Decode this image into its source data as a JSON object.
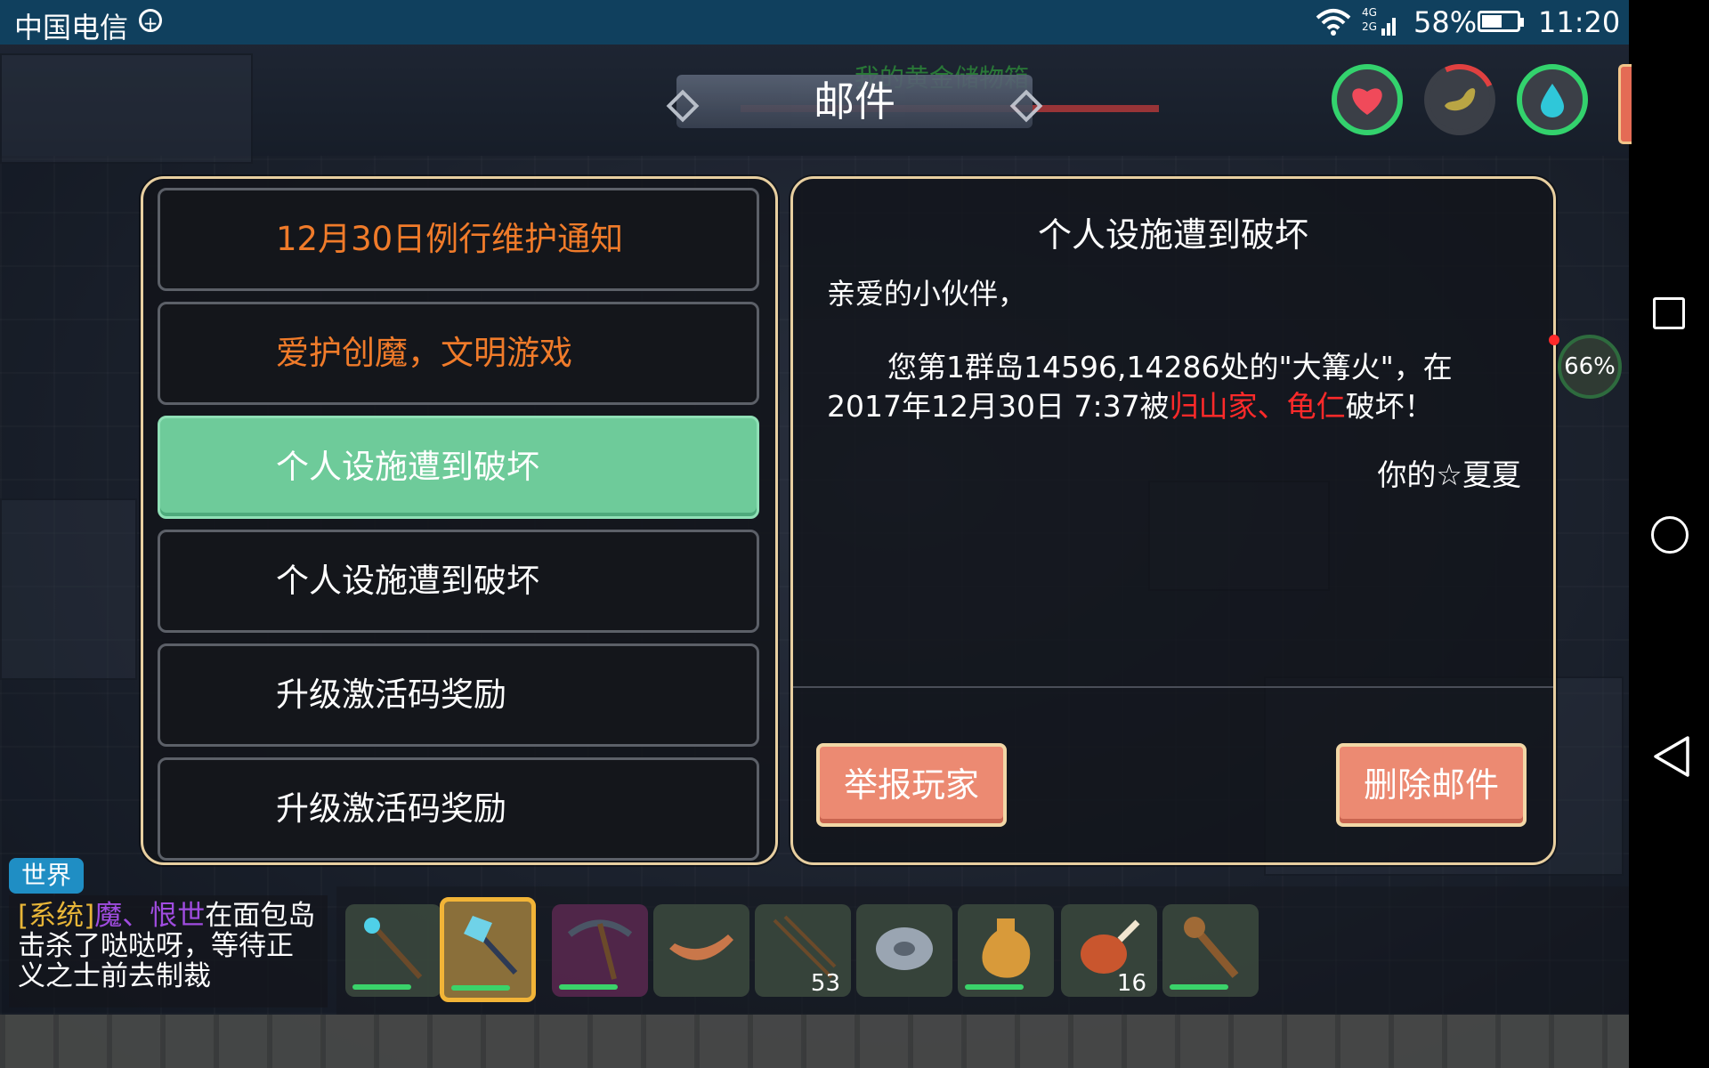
{
  "status_bar": {
    "carrier": "中国电信",
    "battery_percent": "58%",
    "time": "11:20",
    "network_label_top": "4G",
    "network_label_bottom": "2G"
  },
  "hud": {
    "page_title": "邮件",
    "chest_label": "我的黄金储物箱",
    "progress_badge": "66%",
    "health_icon": "heart-icon",
    "hunger_icon": "food-icon",
    "water_icon": "water-drop-icon"
  },
  "mail_list": [
    {
      "subject": "12月30日例行维护通知",
      "color": "#f07b2a",
      "selected": false
    },
    {
      "subject": "爱护创魔，文明游戏",
      "color": "#f07b2a",
      "selected": false
    },
    {
      "subject": "个人设施遭到破坏",
      "color": "#ffffff",
      "selected": true
    },
    {
      "subject": "个人设施遭到破坏",
      "color": "#ffffff",
      "selected": false
    },
    {
      "subject": "升级激活码奖励",
      "color": "#ffffff",
      "selected": false
    },
    {
      "subject": "升级激活码奖励",
      "color": "#ffffff",
      "selected": false
    }
  ],
  "mail_detail": {
    "title": "个人设施遭到破坏",
    "greeting": "亲爱的小伙伴，",
    "body_prefix": "您第1群岛14596,14286处的\"大篝火\"，在2017年12月30日 7:37被",
    "body_highlight": "归山家、龟仁",
    "body_suffix": "破坏！",
    "signature": "你的☆夏夏",
    "report_button": "举报玩家",
    "delete_button": "删除邮件"
  },
  "chat": {
    "tab_label": "世界",
    "system_tag": "[系统]",
    "player_names": "魔、恨世",
    "message": "在面包岛击杀了哒哒呀，等待正义之士前去制裁"
  },
  "hotbar": [
    {
      "icon": "magic-staff-icon",
      "count": "",
      "selected": false,
      "has_bar": true
    },
    {
      "icon": "crystal-axe-icon",
      "count": "",
      "selected": true,
      "has_bar": true
    },
    {
      "icon": "pickaxe-icon",
      "count": "",
      "selected": false,
      "has_bar": true
    },
    {
      "icon": "boat-icon",
      "count": "",
      "selected": false,
      "has_bar": false
    },
    {
      "icon": "arrows-icon",
      "count": "53",
      "selected": false,
      "has_bar": false
    },
    {
      "icon": "shield-disc-icon",
      "count": "",
      "selected": false,
      "has_bar": false
    },
    {
      "icon": "water-flask-icon",
      "count": "",
      "selected": false,
      "has_bar": true
    },
    {
      "icon": "meat-drumstick-icon",
      "count": "16",
      "selected": false,
      "has_bar": false
    },
    {
      "icon": "club-icon",
      "count": "",
      "selected": false,
      "has_bar": true
    }
  ],
  "colors": {
    "accent_green": "#6ecb9a",
    "button_salmon": "#ec8a72",
    "panel_border": "#e8cfa0",
    "highlight_red": "#ff2a2a",
    "orange_text": "#f07b2a"
  }
}
